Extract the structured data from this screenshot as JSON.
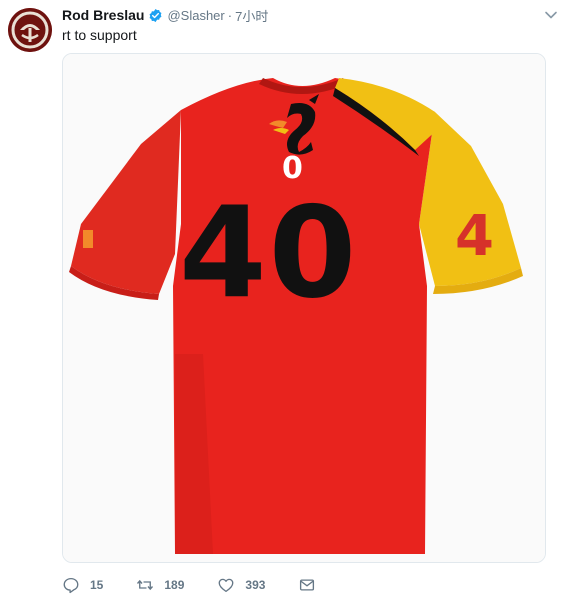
{
  "user": {
    "display_name": "Rod Breslau",
    "handle": "@Slasher",
    "time": "7小时",
    "separator": "·"
  },
  "tweet": {
    "text": "rt to support"
  },
  "media": {
    "jersey_small_number": "0",
    "jersey_big_number": "40",
    "sleeve_number": "4"
  },
  "actions": {
    "reply_count": "15",
    "retweet_count": "189",
    "like_count": "393"
  },
  "colors": {
    "jersey_red": "#e8231e",
    "sleeve_yellow": "#f2c012",
    "text_gray": "#657786",
    "verified_blue": "#1da1f2"
  }
}
